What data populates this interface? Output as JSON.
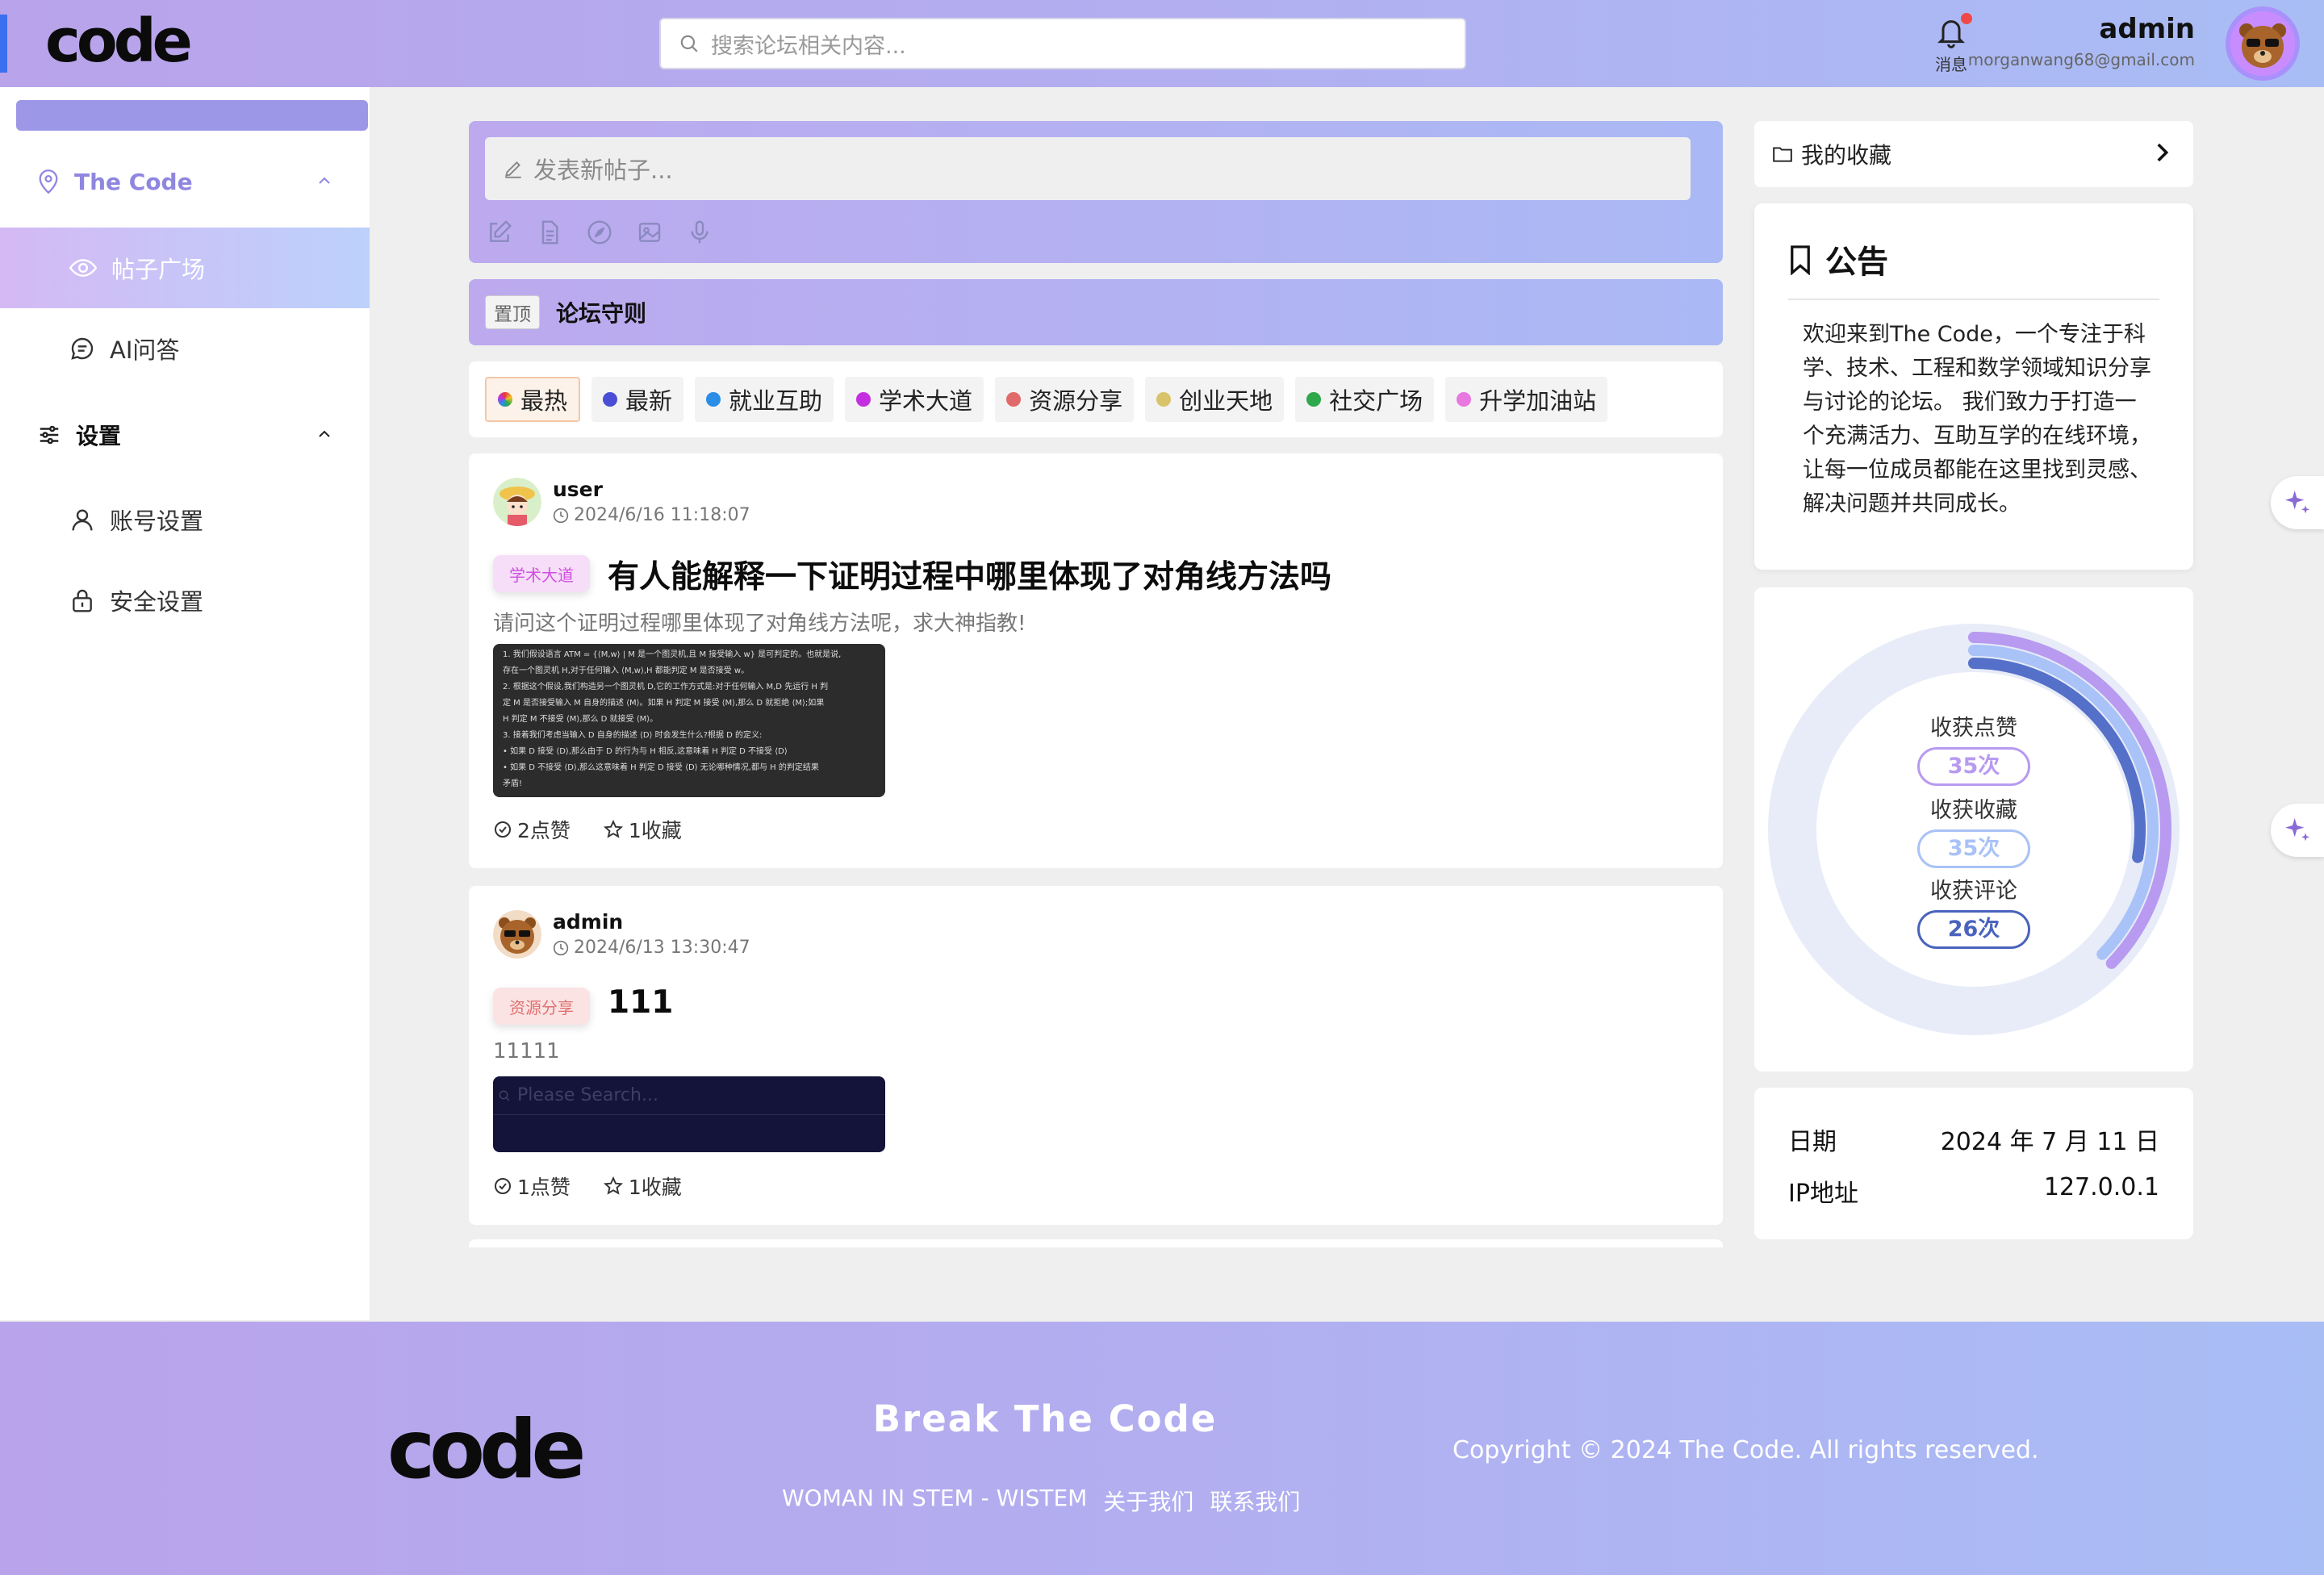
{
  "header": {
    "search_placeholder": "搜索论坛相关内容...",
    "notifications_label": "消息",
    "user_name": "admin",
    "user_email": "morganwang68@gmail.com",
    "logo_text": "code"
  },
  "sidebar": {
    "group1": {
      "label": "The Code"
    },
    "items1": [
      {
        "label": "帖子广场"
      },
      {
        "label": "AI问答"
      }
    ],
    "group2": {
      "label": "设置"
    },
    "items2": [
      {
        "label": "账号设置"
      },
      {
        "label": "安全设置"
      }
    ]
  },
  "composer": {
    "placeholder": "发表新帖子..."
  },
  "pinned": {
    "tag": "置顶",
    "title": "论坛守则"
  },
  "categories": [
    {
      "label": "最热",
      "color": "#e8a020"
    },
    {
      "label": "最新",
      "color": "#4a4ed6"
    },
    {
      "label": "就业互助",
      "color": "#2a8de6"
    },
    {
      "label": "学术大道",
      "color": "#c42ee0"
    },
    {
      "label": "资源分享",
      "color": "#e06a6a"
    },
    {
      "label": "创业天地",
      "color": "#d8c36a"
    },
    {
      "label": "社交广场",
      "color": "#2ea84a"
    },
    {
      "label": "升学加油站",
      "color": "#e878e0"
    }
  ],
  "posts": [
    {
      "author": "user",
      "time": "2024/6/16 11:18:07",
      "tag": "学术大道",
      "title": "有人能解释一下证明过程中哪里体现了对角线方法吗",
      "body": "请问这个证明过程哪里体现了对角线方法呢，求大神指教!",
      "likes": "2点赞",
      "favorites": "1收藏",
      "image_lines": [
        "1. 我们假设语言 ATM = {⟨M,w⟩ | M 是一个图灵机,且 M 接受输入 w} 是可判定的。也就是说,",
        "   存在一个图灵机 H,对于任何输入 ⟨M,w⟩,H 都能判定 M 是否接受 w。",
        "2. 根据这个假设,我们构造另一个图灵机 D,它的工作方式是:对于任何输入 M,D 先运行 H 判",
        "   定 M 是否接受输入 M 自身的描述 ⟨M⟩。如果 H 判定 M 接受 ⟨M⟩,那么 D 就拒绝 ⟨M⟩;如果",
        "   H 判定 M 不接受 ⟨M⟩,那么 D 就接受 ⟨M⟩。",
        "3. 接着我们考虑当输入 D 自身的描述 ⟨D⟩ 时会发生什么?根据 D 的定义:",
        "   • 如果 D 接受 ⟨D⟩,那么由于 D 的行为与 H 相反,这意味着 H 判定 D 不接受 ⟨D⟩",
        "   • 如果 D 不接受 ⟨D⟩,那么这意味着 H 判定 D 接受 ⟨D⟩ 无论哪种情况,都与 H 的判定结果",
        "     矛盾!"
      ]
    },
    {
      "author": "admin",
      "time": "2024/6/13 13:30:47",
      "tag": "资源分享",
      "title": "111",
      "body": "11111",
      "likes": "1点赞",
      "favorites": "1收藏",
      "image_placeholder": "Please Search..."
    }
  ],
  "right": {
    "favorites_label": "我的收藏",
    "notice_title": "公告",
    "notice_body": "欢迎来到The Code，一个专注于科学、技术、工程和数学领域知识分享与讨论的论坛。 我们致力于打造一个充满活力、互助互学的在线环境，让每一位成员都能在这里找到灵感、解决问题并共同成长。",
    "stats": [
      {
        "label": "收获点赞",
        "value": "35次",
        "count": 35,
        "color": "#b89af0"
      },
      {
        "label": "收获收藏",
        "value": "35次",
        "count": 35,
        "color": "#a9c2f7"
      },
      {
        "label": "收获评论",
        "value": "26次",
        "count": 26,
        "color": "#5570c8"
      }
    ],
    "info": [
      {
        "key": "日期",
        "value": "2024 年 7 月 11 日"
      },
      {
        "key": "IP地址",
        "value": "127.0.0.1"
      }
    ]
  },
  "footer": {
    "logo_text": "code",
    "slogan": "Break The Code",
    "links": [
      "WOMAN IN STEM - WISTEM",
      "关于我们",
      "联系我们"
    ],
    "copyright": "Copyright © 2024 The Code. All rights reserved."
  }
}
